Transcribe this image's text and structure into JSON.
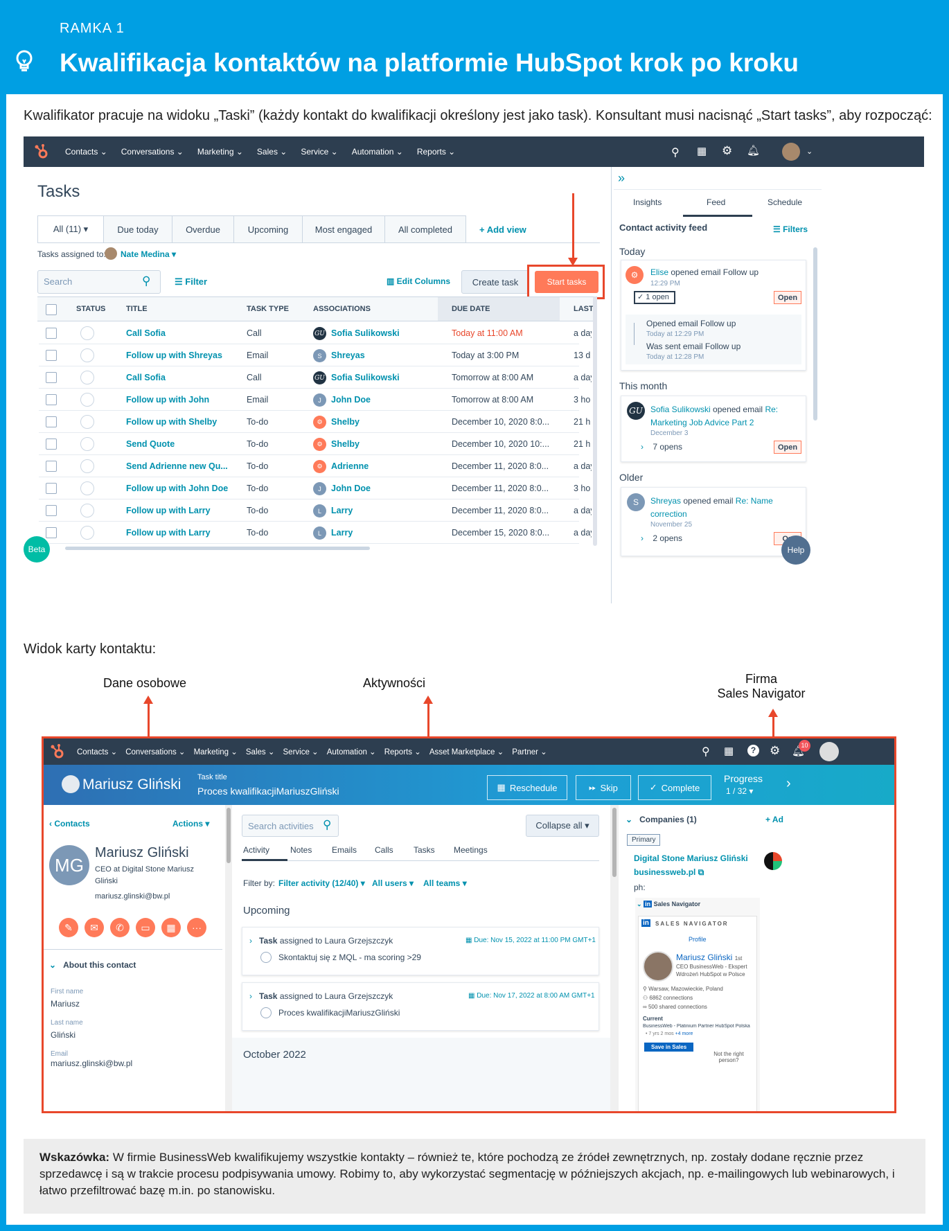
{
  "frame_label": "RAMKA 1",
  "frame_title": "Kwalifikacja kontaktów na platformie HubSpot krok po kroku",
  "intro": "Kwalifikator pracuje na widoku „Taski” (każdy kontakt do kwalifikacji określony jest jako task). Konsultant musi nacisnąć „Start tasks”, aby rozpocząć:",
  "screen1": {
    "nav": [
      "Contacts ⌄",
      "Conversations ⌄",
      "Marketing ⌄",
      "Sales ⌄",
      "Service ⌄",
      "Automation ⌄",
      "Reports ⌄"
    ],
    "title": "Tasks",
    "tabs": [
      "All (11) ▾",
      "Due today",
      "Overdue",
      "Upcoming",
      "Most engaged",
      "All completed"
    ],
    "add_view": "+ Add view",
    "assigned_label": "Tasks assigned to:",
    "assigned_user": "Nate Medina ▾",
    "search_placeholder": "Search",
    "filter": "Filter",
    "edit_columns": "Edit Columns",
    "create_task": "Create task",
    "start_tasks": "Start tasks",
    "headers": [
      "STATUS",
      "TITLE",
      "TASK TYPE",
      "ASSOCIATIONS",
      "DUE DATE",
      "LAST"
    ],
    "rows": [
      {
        "title": "Call Sofia",
        "type": "Call",
        "av": "GU",
        "avc": "gu",
        "assoc": "Sofia Sulikowski",
        "due": "Today at 11:00 AM",
        "last": "a day"
      },
      {
        "title": "Follow up with Shreyas",
        "type": "Email",
        "av": "S",
        "avc": "s",
        "assoc": "Shreyas",
        "due": "Today at 3:00 PM",
        "last": "13 d"
      },
      {
        "title": "Call Sofia",
        "type": "Call",
        "av": "GU",
        "avc": "gu",
        "assoc": "Sofia Sulikowski",
        "due": "Tomorrow at 8:00 AM",
        "last": "a day"
      },
      {
        "title": "Follow up with John",
        "type": "Email",
        "av": "J",
        "avc": "s",
        "assoc": "John Doe",
        "due": "Tomorrow at 8:00 AM",
        "last": "3 ho"
      },
      {
        "title": "Follow up with Shelby",
        "type": "To-do",
        "av": "⚙",
        "avc": "o",
        "assoc": "Shelby",
        "due": "December 10, 2020 8:0...",
        "last": "21 h"
      },
      {
        "title": "Send Quote",
        "type": "To-do",
        "av": "⚙",
        "avc": "o",
        "assoc": "Shelby",
        "due": "December 10, 2020 10:...",
        "last": "21 h"
      },
      {
        "title": "Send Adrienne new Qu...",
        "type": "To-do",
        "av": "⚙",
        "avc": "o",
        "assoc": "Adrienne",
        "due": "December 11, 2020 8:0...",
        "last": "a day"
      },
      {
        "title": "Follow up with John Doe",
        "type": "To-do",
        "av": "J",
        "avc": "s",
        "assoc": "John Doe",
        "due": "December 11, 2020 8:0...",
        "last": "3 ho"
      },
      {
        "title": "Follow up with Larry",
        "type": "To-do",
        "av": "L",
        "avc": "s",
        "assoc": "Larry",
        "due": "December 11, 2020 8:0...",
        "last": "a day"
      },
      {
        "title": "Follow up with Larry",
        "type": "To-do",
        "av": "L",
        "avc": "s",
        "assoc": "Larry",
        "due": "December 15, 2020 8:0...",
        "last": "a day"
      }
    ],
    "beta": "Beta",
    "side_tabs": [
      "Insights",
      "Feed",
      "Schedule"
    ],
    "feed_title": "Contact activity feed",
    "filters": "Filters",
    "today": "Today",
    "elise": "Elise",
    "elise_action": "opened email Follow up",
    "elise_time": "12:29 PM",
    "one_open": "1 open",
    "open": "Open",
    "opened_email": "Opened email Follow up",
    "opened_time": "Today at 12:29 PM",
    "was_sent": "Was sent email Follow up",
    "sent_time": "Today at 12:28 PM",
    "this_month": "This month",
    "sofia": "Sofia Sulikowski",
    "sofia_action": "opened email",
    "sofia_subject": "Re: Marketing Job Advice Part 2",
    "sofia_date": "December 3",
    "seven_opens": "7 opens",
    "older": "Older",
    "shreyas": "Shreyas",
    "shreyas_action": "opened email",
    "shreyas_subject": "Re: Name correction",
    "shreyas_date": "November 25",
    "two_opens": "2 opens",
    "open_cut": "Op",
    "help": "Help"
  },
  "section2_label": "Widok karty kontaktu:",
  "annotations": {
    "personal": "Dane osobowe",
    "activities": "Aktywności",
    "company_l1": "Firma",
    "company_l2": "Sales Navigator"
  },
  "screen2": {
    "nav": [
      "Contacts ⌄",
      "Conversations ⌄",
      "Marketing ⌄",
      "Sales ⌄",
      "Service ⌄",
      "Automation ⌄",
      "Reports ⌄",
      "Asset Marketplace ⌄",
      "Partner ⌄"
    ],
    "badge": "10",
    "contact_name": "Mariusz Gliński",
    "task_title_label": "Task title",
    "task_title": "Proces kwalifikacjiMariuszGliński",
    "reschedule": "Reschedule",
    "skip": "Skip",
    "complete": "Complete",
    "progress_label": "Progress",
    "progress_value": "1 / 32 ▾",
    "contacts_link": "‹ Contacts",
    "actions": "Actions ▾",
    "initials": "MG",
    "name": "Mariusz Gliński",
    "job": "CEO at Digital Stone Mariusz Gliński",
    "email": "mariusz.glinski@bw.pl",
    "about": "About this contact",
    "first_name_label": "First name",
    "first_name": "Mariusz",
    "last_name_label": "Last name",
    "last_name": "Gliński",
    "email_label": "Email",
    "email_value": "mariusz.glinski@bw.pl",
    "search_activities": "Search activities",
    "collapse_all": "Collapse all ▾",
    "tabs": [
      "Activity",
      "Notes",
      "Emails",
      "Calls",
      "Tasks",
      "Meetings"
    ],
    "filter_by": "Filter by:",
    "filter_activity": "Filter activity (12/40) ▾",
    "all_users": "All users ▾",
    "all_teams": "All teams ▾",
    "upcoming": "Upcoming",
    "task_word": "Task",
    "assigned_to": "assigned to Laura Grzejszczyk",
    "due1": "Due: Nov 15, 2022 at 11:00 PM GMT+1",
    "task1": "Skontaktuj się z MQL - ma scoring >29",
    "due2": "Due: Nov 17, 2022 at 8:00 AM GMT+1",
    "task2": "Proces kwalifikacjiMariuszGliński",
    "october": "October 2022",
    "companies": "Companies (1)",
    "add": "+ Ad",
    "primary": "Primary",
    "company_name": "Digital Stone Mariusz Gliński",
    "company_domain": "businessweb.pl",
    "ph": "ph:",
    "sales_nav": "Sales Navigator",
    "sn_header": "SALES NAVIGATOR",
    "sn_profile": "Profile",
    "sn_name": "Mariusz Gliński",
    "sn_degree": "1st",
    "sn_title": "CEO BusinessWeb - Ekspert Wdrożeń HubSpot w Polsce",
    "sn_location": "Warsaw, Mazowieckie, Poland",
    "sn_connections": "6862 connections",
    "sn_shared": "500 shared connections",
    "sn_current": "Current",
    "sn_company": "BusinessWeb - Platinium Partner HubSpot Polska",
    "sn_years": "7 yrs 2 mos",
    "sn_more": "+4 more",
    "save_in_sales": "Save in Sales",
    "not_right": "Not the right person?"
  },
  "tip_label": "Wskazówka:",
  "tip_text": "W firmie BusinessWeb kwalifikujemy wszystkie kontakty – również te, które pochodzą ze źródeł zewnętrznych, np. zostały dodane ręcznie przez sprzedawcę i są w trakcie procesu podpisywania umowy. Robimy to, aby wykorzystać segmentację w późniejszych akcjach, np. e-mailingowych lub webinarowych, i łatwo przefiltrować bazę m.in. po stanowisku.",
  "colors": {
    "frame_blue": "#009fe3",
    "hubspot_orange": "#ff7a59",
    "hubspot_navy": "#2d3e50",
    "link_teal": "#0091ae",
    "annotation_red": "#e8472b"
  }
}
